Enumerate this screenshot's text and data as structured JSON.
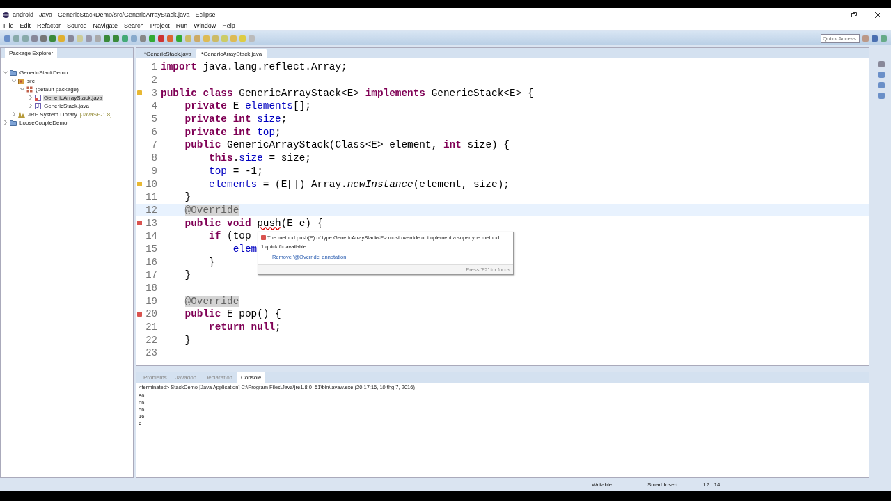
{
  "window": {
    "title": "android - Java - GenericStackDemo/src/GenericArrayStack.java - Eclipse"
  },
  "menu": [
    "File",
    "Edit",
    "Refactor",
    "Source",
    "Navigate",
    "Search",
    "Project",
    "Run",
    "Window",
    "Help"
  ],
  "quick_access": {
    "placeholder": "Quick Access"
  },
  "package_explorer": {
    "title": "Package Explorer",
    "tree": [
      {
        "label": "GenericStackDemo",
        "kind": "project",
        "expanded": true,
        "selected": false,
        "children": [
          {
            "label": "src",
            "kind": "folder",
            "expanded": true,
            "selected": false,
            "children": [
              {
                "label": "(default package)",
                "kind": "package",
                "expanded": true,
                "selected": false,
                "children": [
                  {
                    "label": "GenericArrayStack.java",
                    "kind": "file-error",
                    "expanded": false,
                    "selected": true
                  },
                  {
                    "label": "GenericStack.java",
                    "kind": "file",
                    "expanded": false,
                    "selected": false
                  }
                ]
              }
            ]
          },
          {
            "label": "JRE System Library",
            "decoration": "[JavaSE-1.8]",
            "kind": "library",
            "expanded": false,
            "selected": false
          }
        ]
      },
      {
        "label": "LooseCoupleDemo",
        "kind": "project",
        "expanded": false,
        "selected": false
      }
    ]
  },
  "editor_tabs": [
    {
      "label": "*GenericStack.java",
      "selected": false
    },
    {
      "label": "*GenericArrayStack.java",
      "selected": true
    }
  ],
  "code": [
    {
      "number": "1",
      "tokens": [
        {
          "kind": "kw",
          "text": "import"
        },
        {
          "kind": "plain",
          "text": " java.lang.reflect.Array;"
        }
      ]
    },
    {
      "number": "2"
    },
    {
      "number": "3",
      "warning": true,
      "tokens": [
        {
          "kind": "kw",
          "text": "public class"
        },
        {
          "kind": "plain",
          "text": " GenericArrayStack<E> "
        },
        {
          "kind": "kw",
          "text": "implements"
        },
        {
          "kind": "plain",
          "text": " GenericStack<E> {"
        }
      ]
    },
    {
      "number": "4",
      "tokens": [
        {
          "kind": "kw",
          "text": "    private"
        },
        {
          "kind": "plain",
          "text": " E "
        },
        {
          "kind": "field",
          "text": "elements"
        },
        {
          "kind": "plain",
          "text": "[];"
        }
      ]
    },
    {
      "number": "5",
      "tokens": [
        {
          "kind": "kw",
          "text": "    private int"
        },
        {
          "kind": "field",
          "text": " size"
        },
        {
          "kind": "plain",
          "text": ";"
        }
      ]
    },
    {
      "number": "6",
      "tokens": [
        {
          "kind": "kw",
          "text": "    private int"
        },
        {
          "kind": "field",
          "text": " top"
        },
        {
          "kind": "plain",
          "text": ";"
        }
      ]
    },
    {
      "number": "7",
      "tokens": [
        {
          "kind": "kw",
          "text": "    public"
        },
        {
          "kind": "plain",
          "text": " GenericArrayStack(Class<E> element, "
        },
        {
          "kind": "kw",
          "text": "int"
        },
        {
          "kind": "plain",
          "text": " size) {"
        }
      ]
    },
    {
      "number": "8",
      "tokens": [
        {
          "kind": "kw",
          "text": "        this"
        },
        {
          "kind": "plain",
          "text": "."
        },
        {
          "kind": "field",
          "text": "size"
        },
        {
          "kind": "plain",
          "text": " = size;"
        }
      ]
    },
    {
      "number": "9",
      "tokens": [
        {
          "kind": "field",
          "text": "        top"
        },
        {
          "kind": "plain",
          "text": " = -1;"
        }
      ]
    },
    {
      "number": "10",
      "warning": true,
      "tokens": [
        {
          "kind": "field",
          "text": "        elements"
        },
        {
          "kind": "plain",
          "text": " = (E[]) Array."
        },
        {
          "kind": "static",
          "text": "newInstance"
        },
        {
          "kind": "plain",
          "text": "(element, size);"
        }
      ]
    },
    {
      "number": "11",
      "tokens": [
        {
          "kind": "plain",
          "text": "    }"
        }
      ]
    },
    {
      "number": "12",
      "current": true,
      "tokens": [
        {
          "kind": "ann",
          "text": "    @Override"
        }
      ]
    },
    {
      "number": "13",
      "error": true,
      "tokens": [
        {
          "kind": "kw",
          "text": "    public void "
        },
        {
          "kind": "error",
          "text": "push"
        },
        {
          "kind": "plain",
          "text": "(E e) {"
        }
      ]
    },
    {
      "number": "14",
      "tokens": [
        {
          "kind": "kw",
          "text": "        if"
        },
        {
          "kind": "plain",
          "text": " (top"
        }
      ]
    },
    {
      "number": "15",
      "tokens": [
        {
          "kind": "field",
          "text": "            elem"
        }
      ]
    },
    {
      "number": "16",
      "tokens": [
        {
          "kind": "plain",
          "text": "        }"
        }
      ]
    },
    {
      "number": "17",
      "tokens": [
        {
          "kind": "plain",
          "text": "    }"
        }
      ]
    },
    {
      "number": "18"
    },
    {
      "number": "19",
      "tokens": [
        {
          "kind": "ann",
          "text": "    @Override"
        }
      ]
    },
    {
      "number": "20",
      "error": true,
      "tokens": [
        {
          "kind": "kw",
          "text": "    public"
        },
        {
          "kind": "plain",
          "text": " E pop() {"
        }
      ]
    },
    {
      "number": "21",
      "tokens": [
        {
          "kind": "kw",
          "text": "        return null"
        },
        {
          "kind": "plain",
          "text": ";"
        }
      ]
    },
    {
      "number": "22",
      "tokens": [
        {
          "kind": "plain",
          "text": "    }"
        }
      ]
    },
    {
      "number": "23"
    }
  ],
  "hover": {
    "message": "The method push(E) of type GenericArrayStack<E> must override or implement a supertype method",
    "fix_count": "1 quick fix available:",
    "fix": "Remove '@Override' annotation",
    "footer": "Press 'F2' for focus"
  },
  "bottom_tabs": [
    {
      "label": "Problems",
      "selected": false
    },
    {
      "label": "Javadoc",
      "selected": false
    },
    {
      "label": "Declaration",
      "selected": false
    },
    {
      "label": "Console",
      "selected": true
    }
  ],
  "console": {
    "header": "<terminated> StackDemo [Java Application] C:\\Program Files\\Java\\jre1.8.0_51\\bin\\javaw.exe (20:17:16, 10 thg 7, 2016)",
    "lines": [
      "86",
      "66",
      "56",
      "16",
      "6"
    ]
  },
  "status_bar": [
    "Writable",
    "Smart Insert",
    "12 : 14"
  ]
}
